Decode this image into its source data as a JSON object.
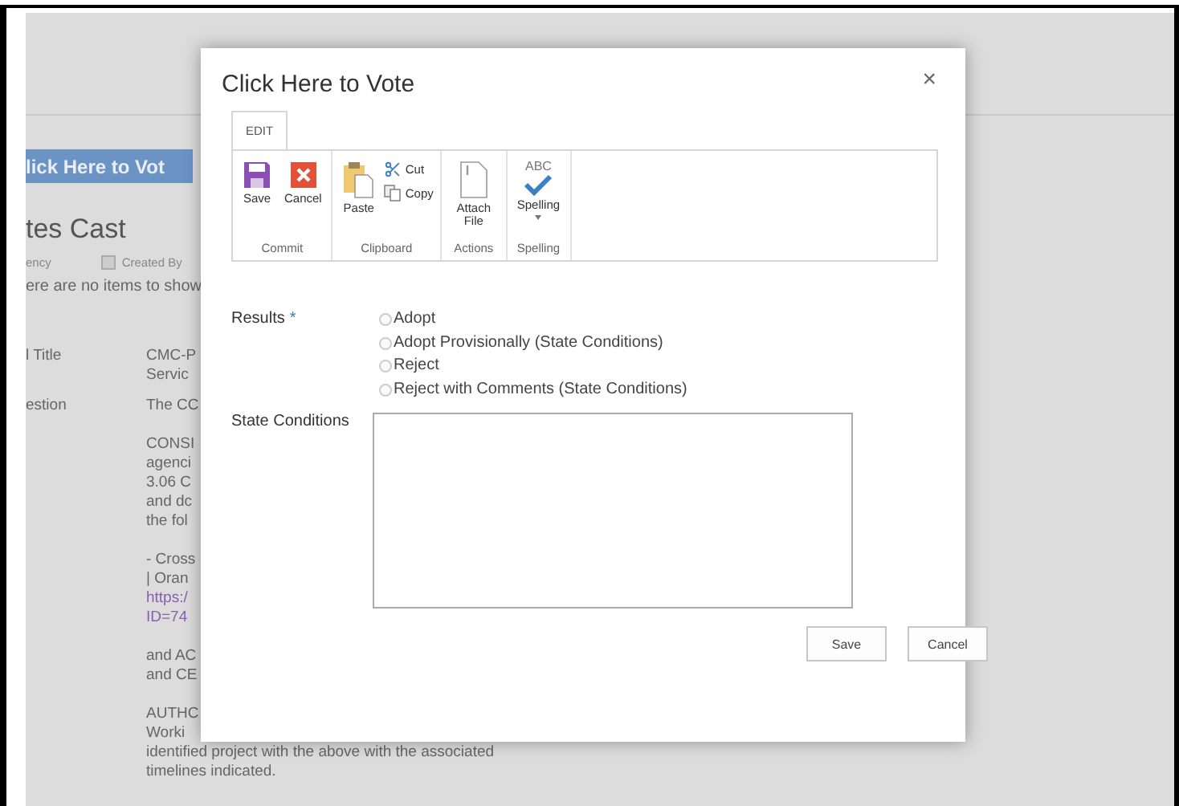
{
  "background": {
    "vote_button": "lick Here to Vot",
    "section_title": "tes Cast",
    "columns": [
      {
        "label": "ency",
        "kind": "text"
      },
      {
        "label": "Created By",
        "kind": "checkbox",
        "checked": false
      }
    ],
    "empty_message": "ere are no items to show",
    "fields": [
      {
        "label": "l Title",
        "paragraphs": [
          [
            {
              "text": "CMC-P",
              "kind": "text"
            },
            {
              "text": "Servic",
              "kind": "text"
            }
          ]
        ]
      },
      {
        "label": "estion",
        "paragraphs": [
          [
            {
              "text": "The CC",
              "kind": "text"
            }
          ],
          [
            {
              "text": "CONSI",
              "kind": "text"
            },
            {
              "text": "agenci",
              "kind": "text"
            },
            {
              "text": "3.06 C",
              "kind": "text"
            },
            {
              "text": "and dc",
              "kind": "text"
            },
            {
              "text": "the fol",
              "kind": "text"
            }
          ],
          [
            {
              "text": "- Cross",
              "kind": "text"
            },
            {
              "text": "| Oran",
              "kind": "text"
            },
            {
              "text": "https:/",
              "kind": "link"
            },
            {
              "text": "ID=74",
              "kind": "link"
            }
          ],
          [
            {
              "text": "and AC",
              "kind": "text"
            },
            {
              "text": "and CE",
              "kind": "text"
            }
          ],
          [
            {
              "text": "AUTHC",
              "kind": "text"
            },
            {
              "text": "Worki",
              "kind": "text"
            },
            {
              "text": "identified project with the above with the associated",
              "kind": "text"
            },
            {
              "text": "timelines indicated.",
              "kind": "text"
            }
          ]
        ]
      }
    ]
  },
  "dialog": {
    "title": "Click Here to Vote",
    "close": "×",
    "tabs": [
      {
        "label": "EDIT",
        "selected": true
      }
    ],
    "ribbon": [
      {
        "label": "Commit",
        "buttons": [
          {
            "label": "Save",
            "kind": "save"
          },
          {
            "label": "Cancel",
            "kind": "cancel"
          }
        ]
      },
      {
        "label": "Clipboard",
        "buttons": [
          {
            "label": "Paste",
            "kind": "paste"
          }
        ],
        "small_buttons": [
          {
            "label": "Cut",
            "kind": "cut"
          },
          {
            "label": "Copy",
            "kind": "copy"
          }
        ]
      },
      {
        "label": "Actions",
        "buttons": [
          {
            "label": "Attach File",
            "kind": "attach"
          }
        ]
      },
      {
        "label": "Spelling",
        "buttons": [
          {
            "label": "Spelling",
            "kind": "spelling",
            "icon_text": "ABC",
            "dropdown": true
          }
        ]
      }
    ],
    "results": {
      "label": "Results",
      "required": "*",
      "options": [
        {
          "label": "Adopt",
          "selected": false
        },
        {
          "label": "Adopt Provisionally (State Conditions)",
          "selected": false
        },
        {
          "label": "Reject",
          "selected": false
        },
        {
          "label": "Reject with Comments (State Conditions)",
          "selected": false
        }
      ]
    },
    "conditions": {
      "label": "State Conditions"
    },
    "buttons": [
      {
        "label": "Save"
      },
      {
        "label": "Cancel"
      }
    ]
  }
}
